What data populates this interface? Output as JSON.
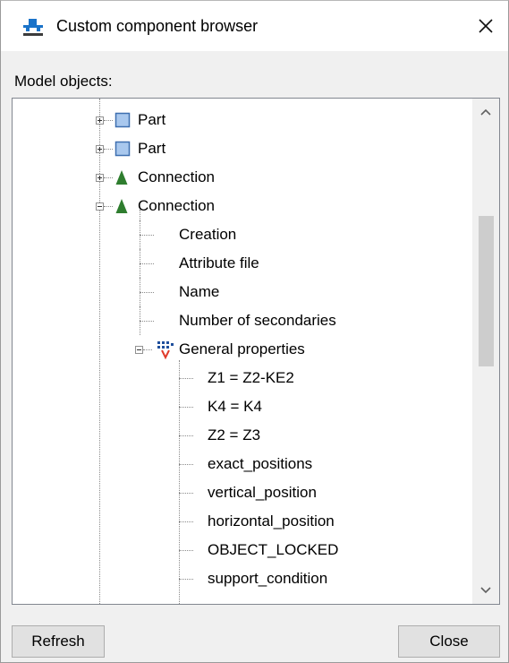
{
  "window": {
    "title": "Custom component browser",
    "close_glyph": "✕",
    "app_icon": "tekla-component-icon"
  },
  "section": {
    "label": "Model objects:"
  },
  "tree": {
    "items": [
      {
        "label": "Part",
        "icon": "part-icon",
        "expanded": false
      },
      {
        "label": "Part",
        "icon": "part-icon",
        "expanded": false
      },
      {
        "label": "Connection",
        "icon": "connection-icon",
        "expanded": false
      },
      {
        "label": "Connection",
        "icon": "connection-icon",
        "expanded": true,
        "children": [
          {
            "label": "Creation"
          },
          {
            "label": "Attribute file"
          },
          {
            "label": "Name"
          },
          {
            "label": "Number of secondaries"
          },
          {
            "label": "General properties",
            "icon": "general-properties-icon",
            "expanded": true,
            "children": [
              {
                "label": "Z1 = Z2-KE2"
              },
              {
                "label": "K4 = K4"
              },
              {
                "label": "Z2 = Z3"
              },
              {
                "label": "exact_positions"
              },
              {
                "label": "vertical_position"
              },
              {
                "label": "horizontal_position"
              },
              {
                "label": "OBJECT_LOCKED"
              },
              {
                "label": "support_condition"
              }
            ]
          }
        ]
      }
    ]
  },
  "scrollbar": {
    "up_glyph": "up-arrow-icon",
    "down_glyph": "down-arrow-icon"
  },
  "buttons": {
    "refresh": "Refresh",
    "close": "Close"
  },
  "colors": {
    "part_icon": "#a9c8ee",
    "part_icon_border": "#3e6fb0",
    "connection_icon": "#2e7d2e",
    "selection_accent": "#0078d7"
  }
}
